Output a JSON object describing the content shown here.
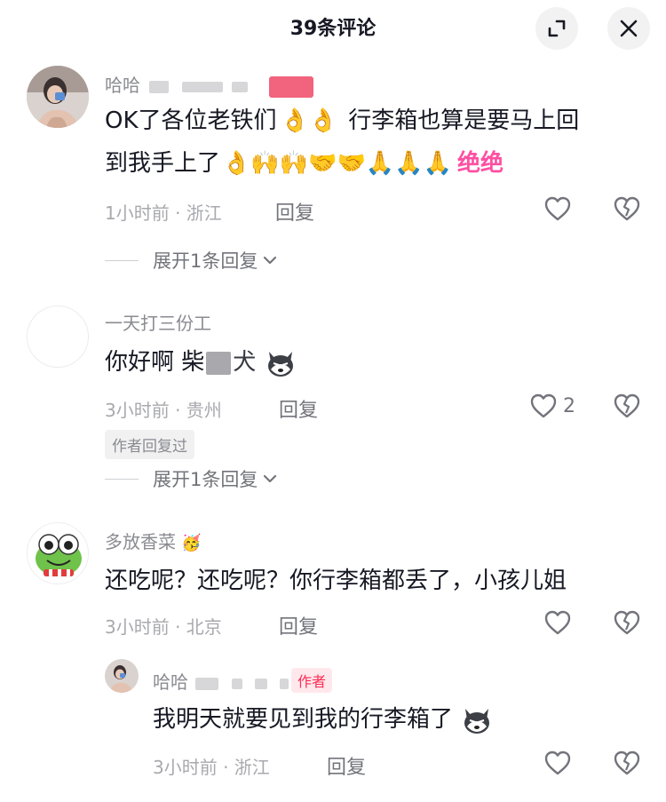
{
  "header": {
    "title": "39条评论"
  },
  "comments": [
    {
      "username": "哈哈",
      "text_a": "OK了各位老铁们",
      "emoji_a": "👌👌",
      "text_b": "行李箱也算是要马上回",
      "text_c": "到我手上了",
      "emoji_b": "👌🙌🙌🤝🤝🙏🙏🙏",
      "text_d": "绝绝",
      "time": "1小时前 · 浙江",
      "reply": "回复",
      "expand": "展开1条回复"
    },
    {
      "username": "一天打三份工",
      "text_a": "你好啊  柴",
      "text_b": "犬",
      "time": "3小时前 · 贵州",
      "reply": "回复",
      "likes": "2",
      "tag": "作者回复过",
      "expand": "展开1条回复"
    },
    {
      "username": "多放香菜",
      "text": "还吃呢？还吃呢？你行李箱都丢了，小孩儿姐",
      "time": "3小时前 · 北京",
      "reply": "回复"
    },
    {
      "username": "哈哈",
      "tag": "作者",
      "text": "我明天就要见到我的行李箱了",
      "time": "3小时前 · 浙江",
      "reply": "回复"
    }
  ],
  "icons": {
    "expand": "expand-icon",
    "close": "close-icon",
    "like": "heart-icon",
    "dislike": "broken-heart-icon",
    "chevron": "chevron-down-icon"
  },
  "colors": {
    "accent": "#fe2c55",
    "text": "#161823",
    "secondary": "#73747b"
  }
}
